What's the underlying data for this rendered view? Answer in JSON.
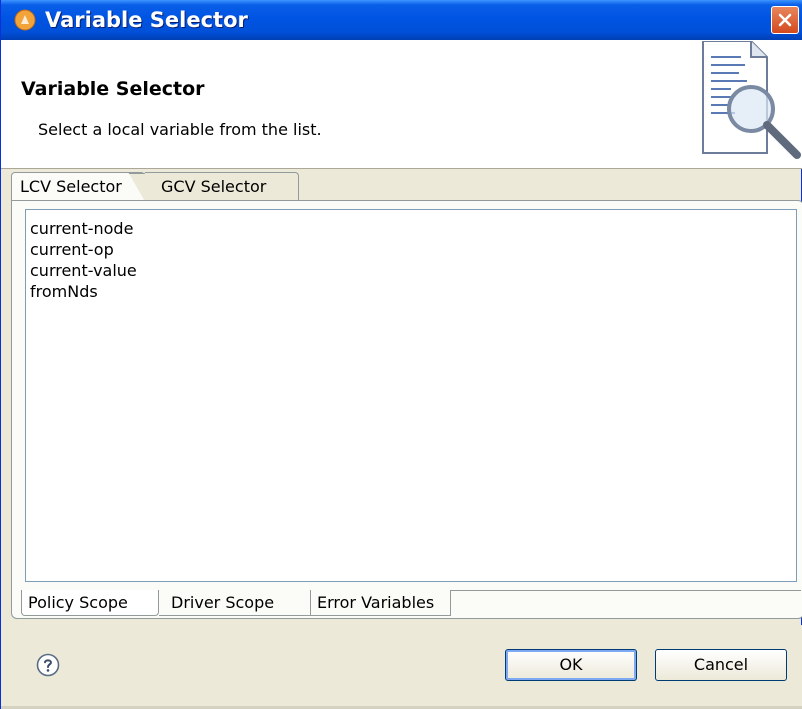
{
  "window": {
    "title": "Variable Selector",
    "close_icon": "close-icon"
  },
  "header": {
    "title": "Variable Selector",
    "description": "Select a local variable from the list.",
    "icon": "document-search-icon"
  },
  "top_tabs": [
    {
      "label": "LCV Selector",
      "selected": true
    },
    {
      "label": "GCV Selector",
      "selected": false
    }
  ],
  "variables": [
    "current-node",
    "current-op",
    "current-value",
    "fromNds"
  ],
  "bottom_tabs": [
    {
      "label": "Policy Scope",
      "selected": true
    },
    {
      "label": "Driver Scope",
      "selected": false
    },
    {
      "label": "Error Variables",
      "selected": false
    }
  ],
  "buttons": {
    "ok": "OK",
    "cancel": "Cancel",
    "help_icon": "help-icon"
  },
  "colors": {
    "titlebar": "#0054e3",
    "dialog_bg": "#ece9d8",
    "accent": "#003c74"
  }
}
